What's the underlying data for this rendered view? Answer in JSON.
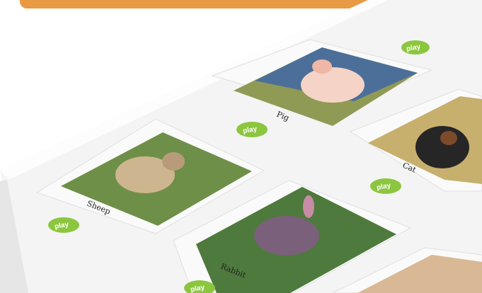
{
  "header": {
    "accent_color": "#e99a44"
  },
  "cards": [
    {
      "name": "pig",
      "label": "Pig",
      "play": "play"
    },
    {
      "name": "cat",
      "label": "Cat",
      "play": "play"
    },
    {
      "name": "sheep",
      "label": "Sheep",
      "play": "play"
    },
    {
      "name": "rabbit",
      "label": "Rabbit",
      "play": "play"
    },
    {
      "name": "bottom-right",
      "label": "",
      "play": "play"
    }
  ],
  "colors": {
    "play_badge": "#8cc63f",
    "grass": "#5f8b3f",
    "sky": "#4c6f9a"
  }
}
